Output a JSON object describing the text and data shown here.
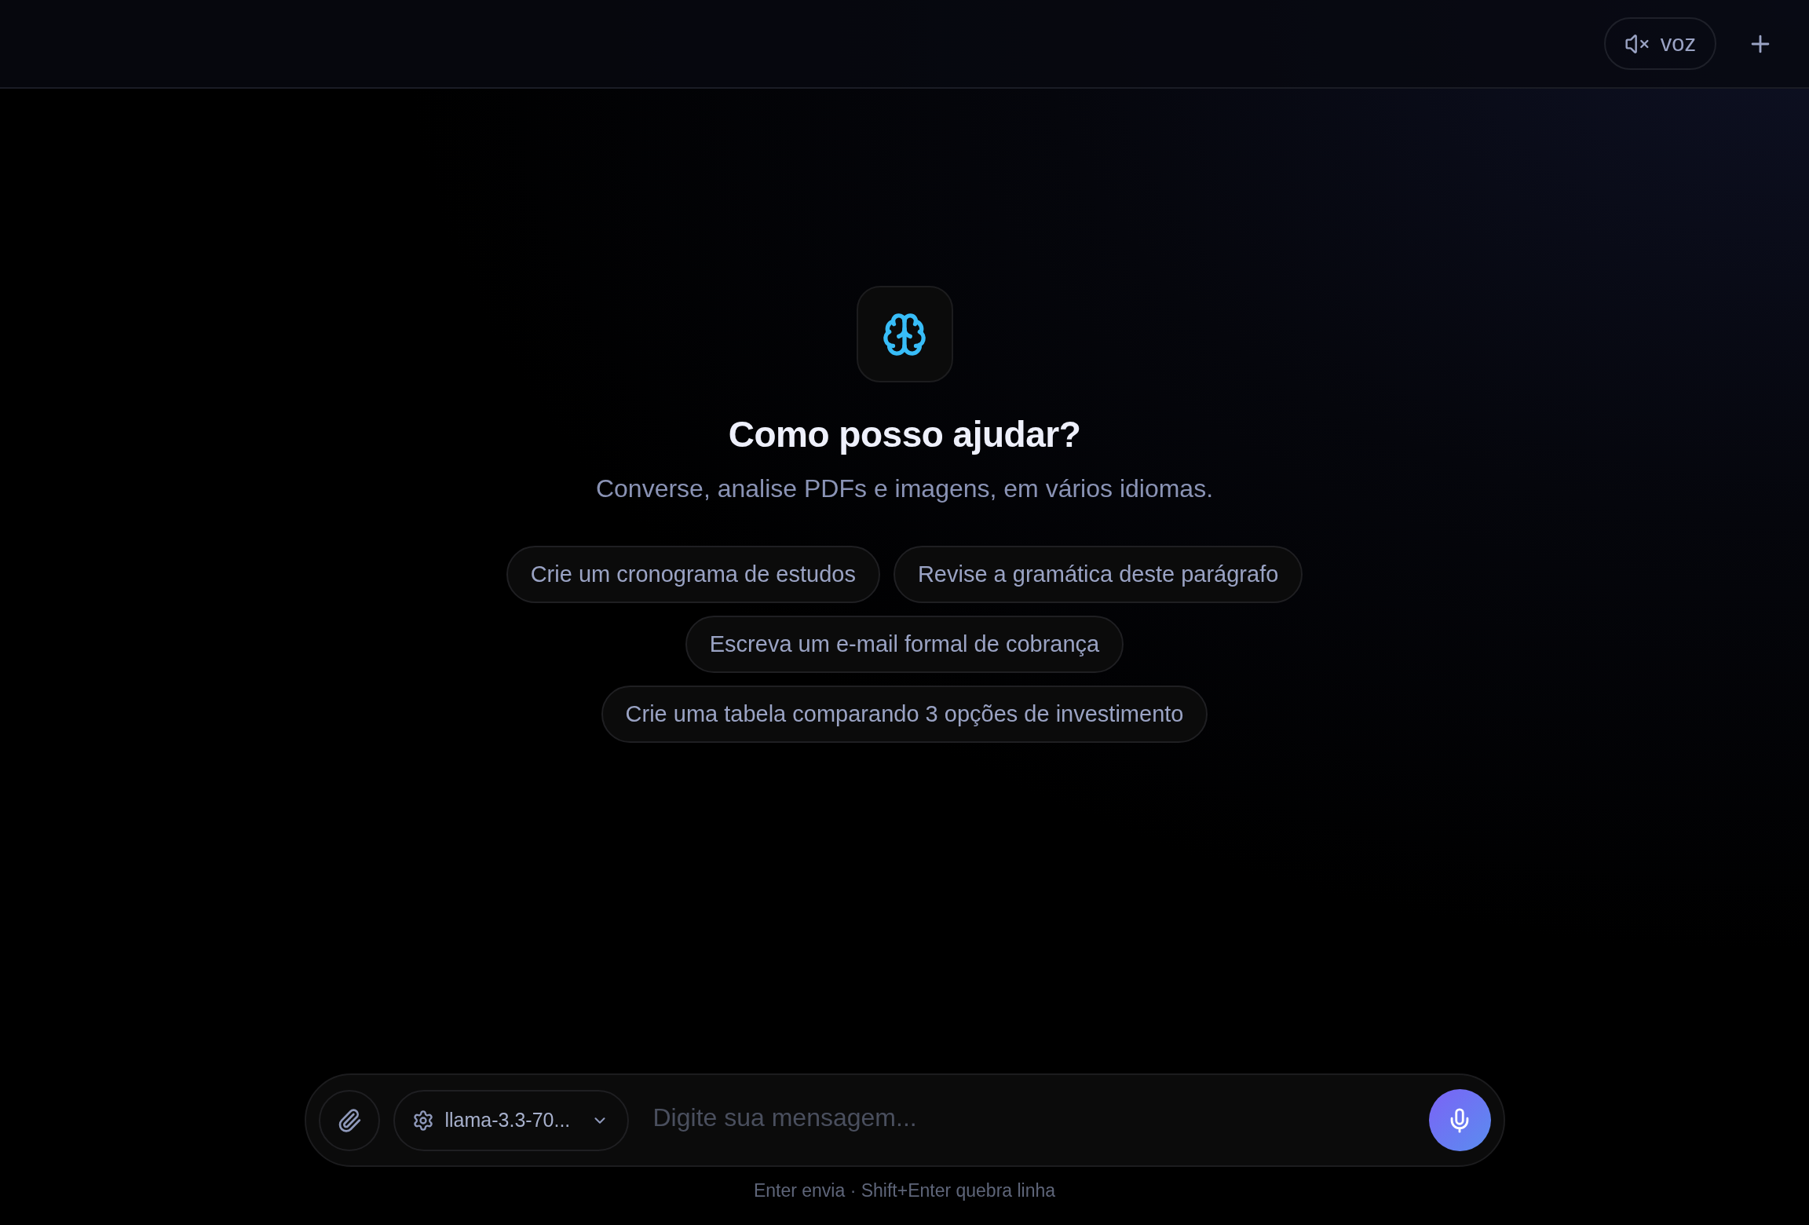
{
  "header": {
    "voice_button": {
      "label": "voz",
      "muted": true
    }
  },
  "hero": {
    "title": "Como posso ajudar?",
    "subtitle": "Converse, analise PDFs e imagens, em vários idiomas."
  },
  "suggestions": [
    "Crie um cronograma de estudos",
    "Revise a gramática deste parágrafo",
    "Escreva um e-mail formal de cobrança",
    "Crie uma tabela comparando 3 opções de investimento"
  ],
  "composer": {
    "model": "llama-3.3-70...",
    "placeholder": "Digite sua mensagem..."
  },
  "hint": "Enter envia · Shift+Enter quebra linha"
}
